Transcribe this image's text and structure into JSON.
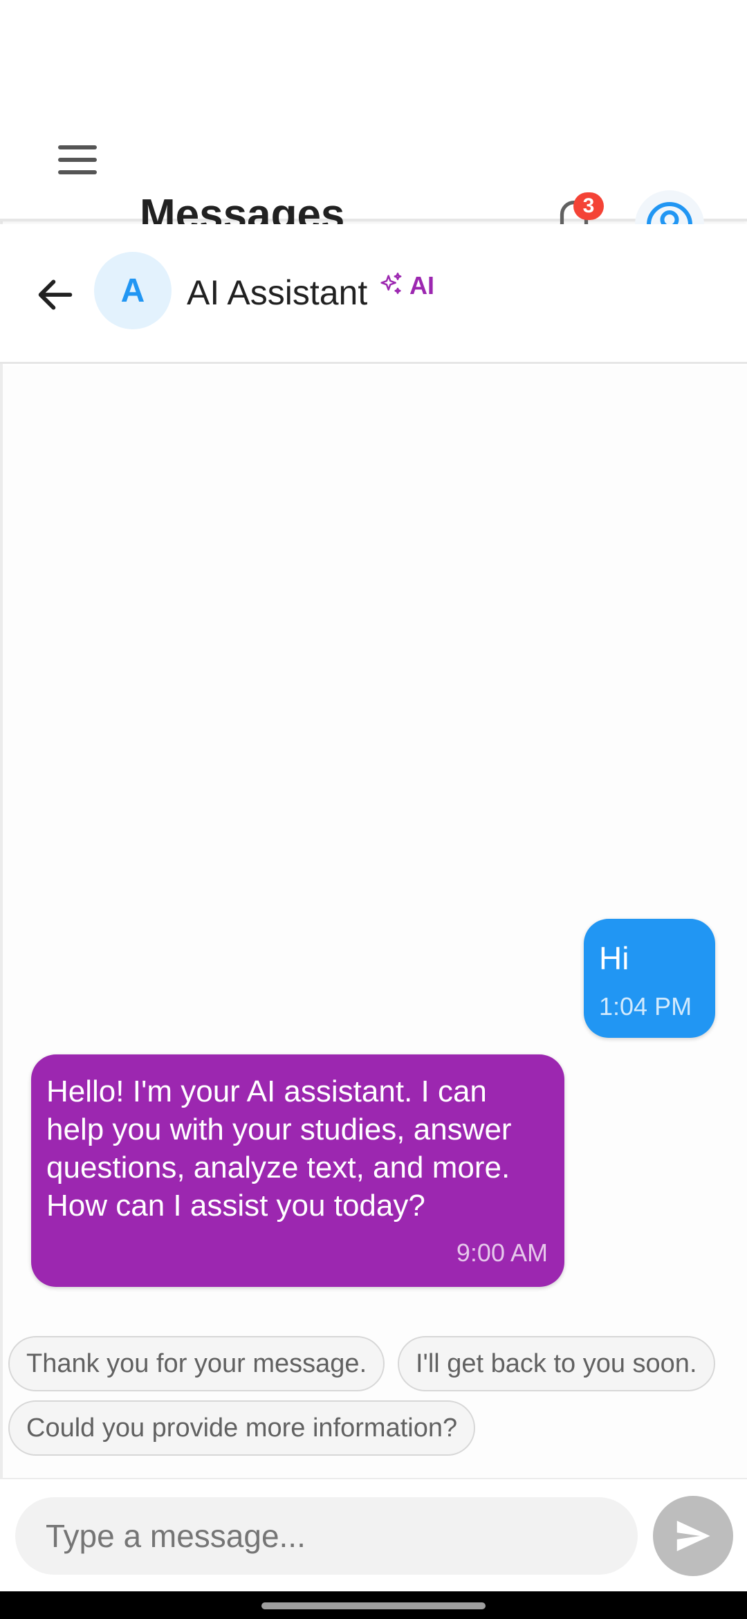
{
  "app_bar": {
    "title": "Messages",
    "notification_count": "3",
    "colors": {
      "badge": "#f44336",
      "profile": "#2196f3"
    }
  },
  "chat_header": {
    "avatar_letter": "A",
    "contact_name": "AI Assistant",
    "ai_badge": "AI"
  },
  "messages": [
    {
      "direction": "outgoing",
      "text": "Hi",
      "time": "1:04 PM",
      "color": "#2196f3"
    },
    {
      "direction": "incoming",
      "text": "Hello! I'm your AI assistant. I can help you with your studies, answer questions, analyze text, and more. How can I assist you today?",
      "time": "9:00 AM",
      "color": "#9c27b0"
    }
  ],
  "quick_replies": [
    "Thank you for your message.",
    "I'll get back to you soon.",
    "Could you provide more information?"
  ],
  "input": {
    "value": "",
    "placeholder": "Type a message..."
  }
}
